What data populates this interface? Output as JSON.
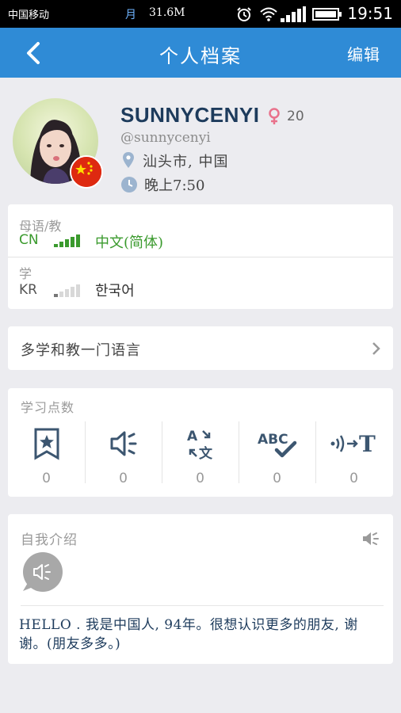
{
  "status_bar": {
    "carrier": "中国移动",
    "moon_glyph": "月",
    "data_speed": "31.6M",
    "time": "19:51",
    "icons": [
      "alarm-icon",
      "wifi-icon",
      "signal-icon",
      "battery-icon"
    ]
  },
  "app_bar": {
    "back_icon": "chevron-left-icon",
    "title": "个人档案",
    "edit_label": "编辑"
  },
  "profile": {
    "username": "SUNNYCENYI",
    "gender": "female",
    "age": "20",
    "handle": "@sunnycenyi",
    "location": "汕头市, 中国",
    "local_time": "晚上7:50",
    "flag": "china-flag"
  },
  "languages": {
    "native_label": "母语/教",
    "native_code": "CN",
    "native_name": "中文(简体)",
    "native_level": 5,
    "learning_label": "学",
    "learning_code": "KR",
    "learning_name": "한국어",
    "learning_level": 1
  },
  "more_languages": {
    "label": "多学和教一门语言"
  },
  "points": {
    "header": "学习点数",
    "items": [
      {
        "icon": "bookmark-star-icon",
        "value": "0"
      },
      {
        "icon": "speaker-icon",
        "value": "0"
      },
      {
        "icon": "translate-icon",
        "value": "0"
      },
      {
        "icon": "spellcheck-abc-icon",
        "value": "0"
      },
      {
        "icon": "transliterate-icon",
        "value": "0"
      }
    ]
  },
  "intro": {
    "header": "自我介绍",
    "text": "HELLO . 我是中国人, 94年。很想认识更多的朋友, 谢谢。(朋友多多。)"
  },
  "colors": {
    "app_bar": "#2f8bd6",
    "native_green": "#3a9a2d",
    "username": "#1d3b5c",
    "gender_pink": "#e9728c"
  }
}
